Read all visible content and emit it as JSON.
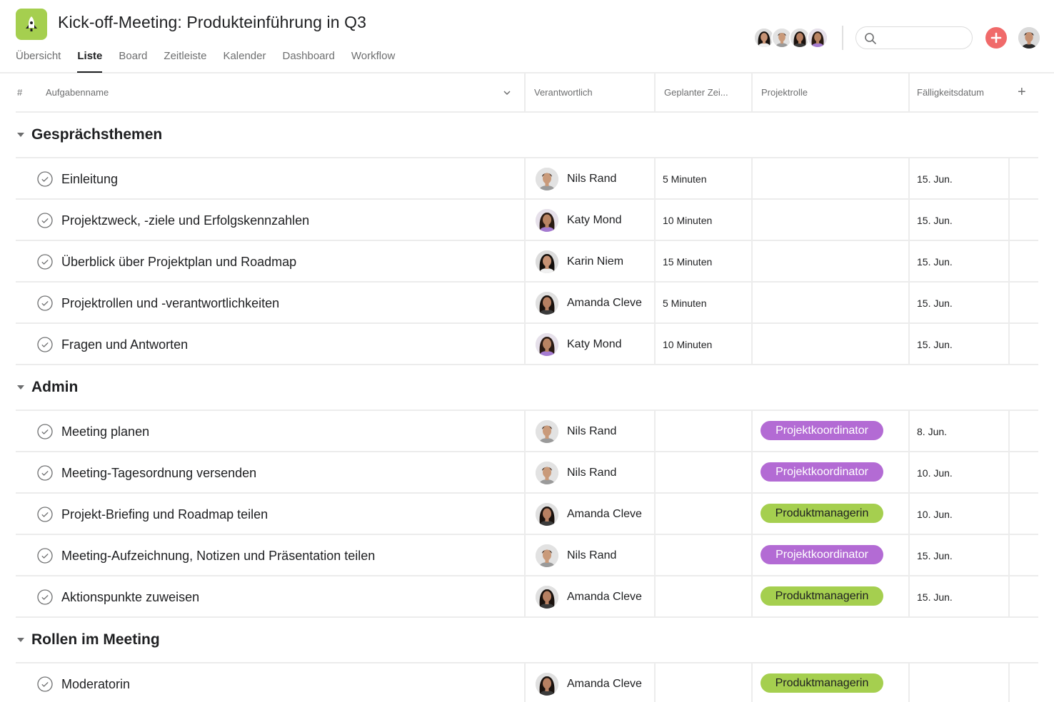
{
  "header": {
    "project_icon": "rocket-icon",
    "project_color": "#a5cf4f",
    "title": "Kick-off-Meeting: Produkteinführung in Q3",
    "tabs": [
      {
        "label": "Übersicht",
        "active": false
      },
      {
        "label": "Liste",
        "active": true
      },
      {
        "label": "Board",
        "active": false
      },
      {
        "label": "Zeitleiste",
        "active": false
      },
      {
        "label": "Kalender",
        "active": false
      },
      {
        "label": "Dashboard",
        "active": false
      },
      {
        "label": "Workflow",
        "active": false
      }
    ],
    "members": [
      "Karin Niem",
      "Nils Rand",
      "Amanda Cleve",
      "Katy Mond"
    ],
    "search": {
      "placeholder": "",
      "value": ""
    },
    "add_button_icon": "plus-icon",
    "add_button_color": "#f06a6a"
  },
  "table": {
    "columns": {
      "number": "#",
      "task_name": "Aufgabenname",
      "assignee": "Verantwortlich",
      "planned_time": "Geplanter Zei...",
      "project_role": "Projektrolle",
      "due_date": "Fälligkeitsdatum",
      "add_column": "+"
    },
    "role_colors": {
      "Projektkoordinator": {
        "bg": "#b36bd4",
        "fg": "#ffffff"
      },
      "Produktmanagerin": {
        "bg": "#a5cf4f",
        "fg": "#1e1f21"
      }
    },
    "sections": [
      {
        "title": "Gesprächsthemen",
        "tasks": [
          {
            "name": "Einleitung",
            "assignee": "Nils Rand",
            "time": "5 Minuten",
            "role": "",
            "due": "15. Jun."
          },
          {
            "name": "Projektzweck, -ziele und Erfolgskennzahlen",
            "assignee": "Katy Mond",
            "time": "10 Minuten",
            "role": "",
            "due": "15. Jun."
          },
          {
            "name": "Überblick über Projektplan und Roadmap",
            "assignee": "Karin Niem",
            "time": "15 Minuten",
            "role": "",
            "due": "15. Jun."
          },
          {
            "name": "Projektrollen und -verantwortlichkeiten",
            "assignee": "Amanda Cleve",
            "time": "5 Minuten",
            "role": "",
            "due": "15. Jun."
          },
          {
            "name": "Fragen und Antworten",
            "assignee": "Katy Mond",
            "time": "10 Minuten",
            "role": "",
            "due": "15. Jun."
          }
        ]
      },
      {
        "title": "Admin",
        "tasks": [
          {
            "name": "Meeting planen",
            "assignee": "Nils Rand",
            "time": "",
            "role": "Projektkoordinator",
            "due": "8. Jun."
          },
          {
            "name": "Meeting-Tagesordnung versenden",
            "assignee": "Nils Rand",
            "time": "",
            "role": "Projektkoordinator",
            "due": "10. Jun."
          },
          {
            "name": "Projekt-Briefing und Roadmap teilen",
            "assignee": "Amanda Cleve",
            "time": "",
            "role": "Produktmanagerin",
            "due": "10. Jun."
          },
          {
            "name": "Meeting-Aufzeichnung, Notizen und Präsentation teilen",
            "assignee": "Nils Rand",
            "time": "",
            "role": "Projektkoordinator",
            "due": "15. Jun."
          },
          {
            "name": "Aktionspunkte zuweisen",
            "assignee": "Amanda Cleve",
            "time": "",
            "role": "Produktmanagerin",
            "due": "15. Jun."
          }
        ]
      },
      {
        "title": "Rollen im Meeting",
        "tasks": [
          {
            "name": "Moderatorin",
            "assignee": "Amanda Cleve",
            "time": "",
            "role": "Produktmanagerin",
            "due": ""
          }
        ]
      }
    ]
  }
}
